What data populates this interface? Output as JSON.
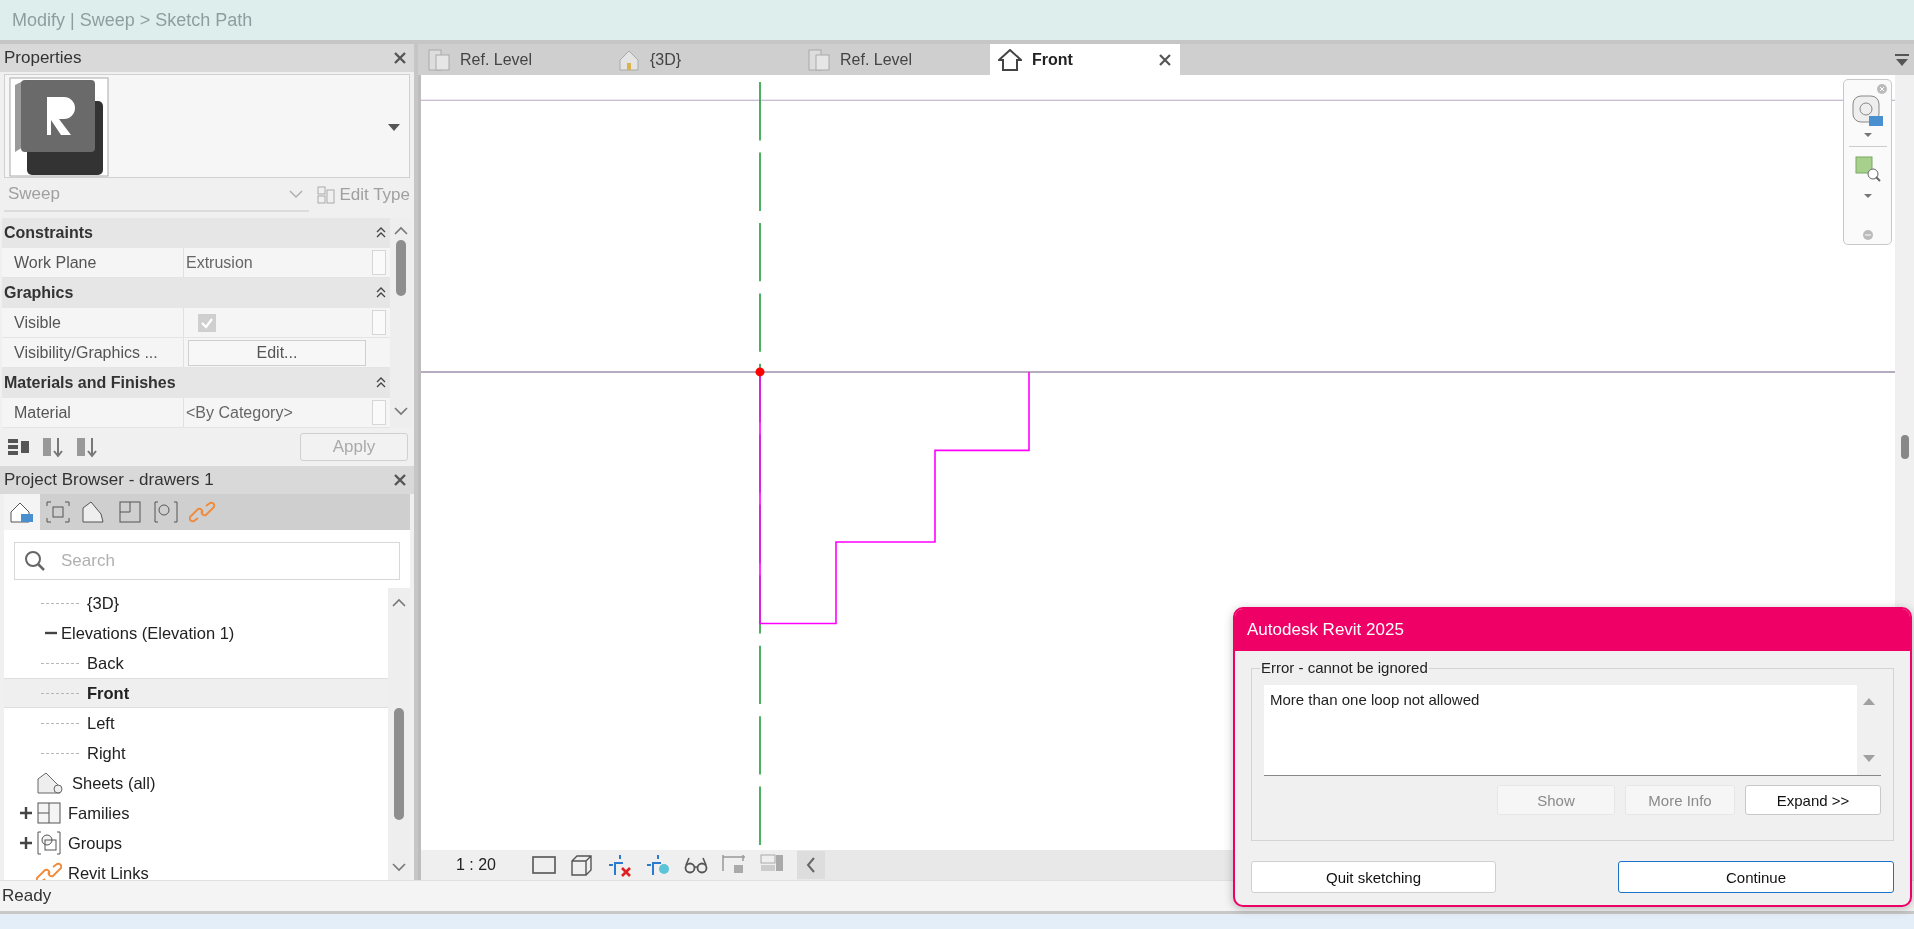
{
  "context_title": "Modify | Sweep > Sketch Path",
  "properties": {
    "title": "Properties",
    "type_name": "Sweep",
    "edit_type": "Edit Type",
    "sections": [
      {
        "title": "Constraints",
        "expanded": true,
        "rows": [
          {
            "label": "Work Plane",
            "kind": "text",
            "value": "Extrusion"
          }
        ]
      },
      {
        "title": "Graphics",
        "expanded": true,
        "rows": [
          {
            "label": "Visible",
            "kind": "checkbox",
            "checked": true
          },
          {
            "label": "Visibility/Graphics ...",
            "kind": "button",
            "value": "Edit..."
          }
        ]
      },
      {
        "title": "Materials and Finishes",
        "expanded": true,
        "rows": [
          {
            "label": "Material",
            "kind": "text",
            "value": "<By Category>"
          }
        ]
      }
    ],
    "apply": "Apply"
  },
  "project_browser": {
    "title": "Project Browser - drawers 1",
    "search_placeholder": "Search",
    "tree": [
      {
        "children": [
          {
            "children": [
              {
                "label": "{3D}",
                "selected": false
              }
            ]
          },
          {
            "label": "Elevations (Elevation 1)",
            "expanded": true,
            "selected": false,
            "children": [
              {
                "label": "Back",
                "selected": false
              },
              {
                "label": "Front",
                "selected": true
              },
              {
                "label": "Left",
                "selected": false
              },
              {
                "label": "Right",
                "selected": false
              }
            ]
          }
        ]
      },
      {
        "label": "Sheets (all)",
        "kind": "sheet",
        "selected": false
      },
      {
        "label": "Families",
        "kind": "family",
        "expanded": false,
        "selected": false
      },
      {
        "label": "Groups",
        "kind": "group",
        "expanded": false,
        "selected": false
      },
      {
        "label": "Revit Links",
        "kind": "link",
        "selected": false
      }
    ]
  },
  "tabs": [
    {
      "label": "Ref. Level",
      "kind": "plan",
      "selected": false
    },
    {
      "label": "{3D}",
      "kind": "house",
      "selected": false
    },
    {
      "label": "Ref. Level",
      "kind": "plan",
      "selected": false
    },
    {
      "label": "Front",
      "kind": "elevation",
      "selected": true
    }
  ],
  "view_bar": {
    "scale": "1 : 20"
  },
  "status_bar": "Ready",
  "dialog": {
    "title": "Autodesk Revit 2025",
    "group_label": "Error - cannot be ignored",
    "message": "More than one loop not allowed",
    "buttons": [
      {
        "label": "Show",
        "disabled": true
      },
      {
        "label": "More Info",
        "disabled": true
      },
      {
        "label": "Expand >>",
        "disabled": false
      }
    ],
    "footer_buttons": [
      {
        "label": "Quit sketching",
        "default": false
      },
      {
        "label": "Continue",
        "default": true
      }
    ]
  }
}
